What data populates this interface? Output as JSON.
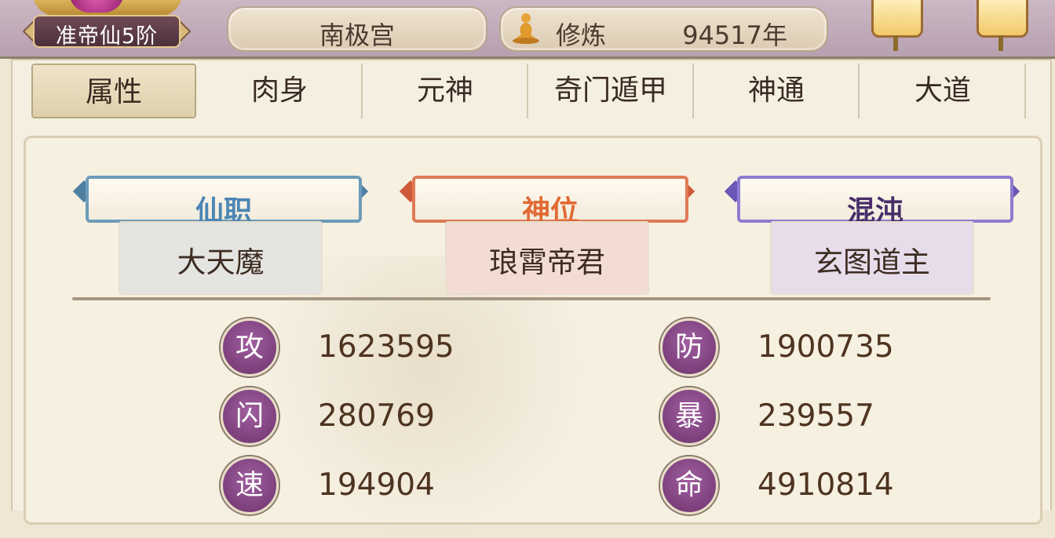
{
  "header": {
    "rank": "准帝仙5阶",
    "location": "南极宫",
    "cultivation": {
      "label": "修炼",
      "value": "94517年"
    }
  },
  "tabs": [
    {
      "label": "属性",
      "active": true
    },
    {
      "label": "肉身",
      "active": false
    },
    {
      "label": "元神",
      "active": false
    },
    {
      "label": "奇门遁甲",
      "active": false
    },
    {
      "label": "神通",
      "active": false
    },
    {
      "label": "大道",
      "active": false
    }
  ],
  "titles": [
    {
      "banner": "仙职",
      "value": "大天魔",
      "color": "#4c86b4"
    },
    {
      "banner": "神位",
      "value": "琅霄帝君",
      "color": "#e06a33"
    },
    {
      "banner": "混沌",
      "value": "玄图道主",
      "color": "#4a2e6a"
    }
  ],
  "stats": [
    {
      "icon": "攻",
      "value": "1623595"
    },
    {
      "icon": "防",
      "value": "1900735"
    },
    {
      "icon": "闪",
      "value": "280769"
    },
    {
      "icon": "暴",
      "value": "239557"
    },
    {
      "icon": "速",
      "value": "194904"
    },
    {
      "icon": "命",
      "value": "4910814"
    }
  ],
  "colors": {
    "stat_badge": "#7a3b78",
    "active_tab": "#ded0ac",
    "value_text": "#4e3420"
  }
}
